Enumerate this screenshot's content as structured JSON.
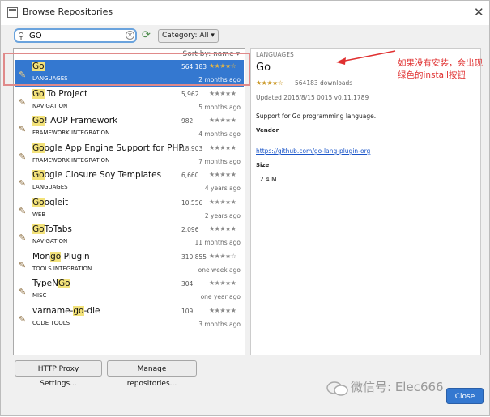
{
  "window": {
    "title": "Browse Repositories",
    "close_glyph": "✕"
  },
  "toolbar": {
    "search_value": "GO",
    "search_glyph": "⚲",
    "clear_glyph": "✕",
    "refresh_glyph": "⟳",
    "category_label": "Category: All",
    "category_caret": "▾"
  },
  "list": {
    "sort_label": "Sort by: name ▾",
    "items": [
      {
        "pre": "",
        "hl": "Go",
        "post": "",
        "category": "LANGUAGES",
        "downloads": "564,183",
        "stars": "★★★★☆",
        "date": "2 months ago",
        "icon": "plug-icon"
      },
      {
        "pre": "",
        "hl": "Go",
        "post": " To Project",
        "category": "NAVIGATION",
        "downloads": "5,962",
        "stars": "★★★★★",
        "date": "5 months ago",
        "icon": "plug-icon"
      },
      {
        "pre": "",
        "hl": "Go",
        "post": "! AOP Framework",
        "category": "FRAMEWORK INTEGRATION",
        "downloads": "982",
        "stars": "★★★★★",
        "date": "4 months ago",
        "icon": "plug-icon"
      },
      {
        "pre": "",
        "hl": "Go",
        "post": "ogle App Engine Support for PHP",
        "category": "FRAMEWORK INTEGRATION",
        "downloads": "18,903",
        "stars": "★★★★★",
        "date": "7 months ago",
        "icon": "plug-icon"
      },
      {
        "pre": "",
        "hl": "Go",
        "post": "ogle Closure Soy Templates",
        "category": "LANGUAGES",
        "downloads": "6,660",
        "stars": "★★★★★",
        "date": "4 years ago",
        "icon": "plug-icon"
      },
      {
        "pre": "",
        "hl": "Go",
        "post": "ogleit",
        "category": "WEB",
        "downloads": "10,556",
        "stars": "★★★★★",
        "date": "2 years ago",
        "icon": "plug-icon"
      },
      {
        "pre": "",
        "hl": "Go",
        "post": "ToTabs",
        "category": "NAVIGATION",
        "downloads": "2,096",
        "stars": "★★★★★",
        "date": "11 months ago",
        "icon": "plug-icon"
      },
      {
        "pre": "Mon",
        "hl": "go",
        "post": " Plugin",
        "category": "TOOLS INTEGRATION",
        "downloads": "310,855",
        "stars": "★★★★☆",
        "date": "one week ago",
        "icon": "plug-icon"
      },
      {
        "pre": "TypeN",
        "hl": "Go",
        "post": "",
        "category": "MISC",
        "downloads": "304",
        "stars": "★★★★★",
        "date": "one year ago",
        "icon": "plug-icon"
      },
      {
        "pre": "varname-",
        "hl": "go",
        "post": "-die",
        "category": "CODE TOOLS",
        "downloads": "109",
        "stars": "★★★★★",
        "date": "3 months ago",
        "icon": "plug-icon"
      }
    ]
  },
  "detail": {
    "category": "LANGUAGES",
    "name": "Go",
    "stars": "★★★★☆",
    "downloads": "564183 downloads",
    "updated": "Updated 2016/8/15 0015    v0.11.1789",
    "description": "Support for Go programming language.",
    "vendor_label": "Vendor",
    "link": "https://github.com/go-lang-plugin-org",
    "size_label": "Size",
    "size": "12.4 M"
  },
  "annotation": {
    "text": "如果没有安装，会出现绿色的install按钮",
    "color": "#e03030"
  },
  "footer": {
    "proxy_button": "HTTP Proxy Settings...",
    "repos_button": "Manage repositories...",
    "close_button": "Close"
  },
  "watermark": {
    "text": "微信号: Elec666"
  },
  "colors": {
    "selection": "#3478d0",
    "highlight": "#f3e27a",
    "selection_outline": "#e08a8a"
  }
}
